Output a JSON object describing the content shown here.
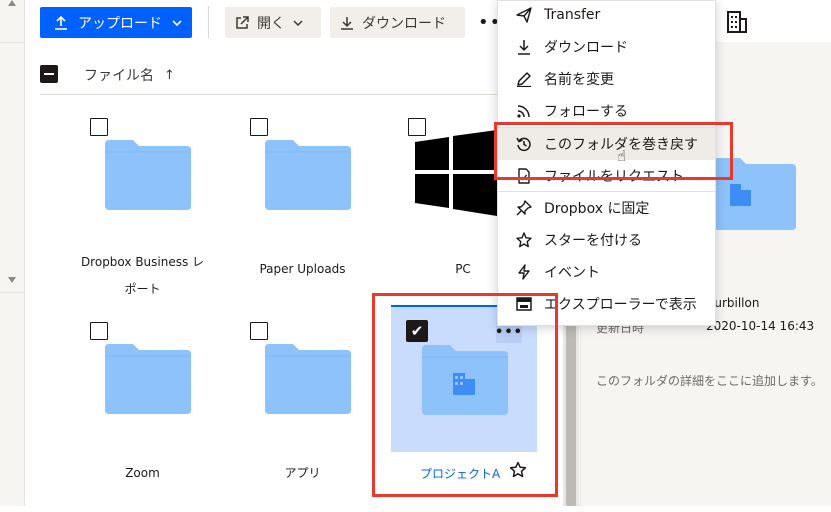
{
  "toolbar": {
    "upload_label": "アップロード",
    "open_label": "開く",
    "download_label": "ダウンロード",
    "more_label": "•••"
  },
  "list_header": {
    "name_label": "ファイル名",
    "sort_indicator": "↑"
  },
  "grid": {
    "items": [
      {
        "label_line1": "Dropbox Business レ",
        "label_line2": "ポート",
        "type": "folder"
      },
      {
        "label": "Paper Uploads",
        "type": "folder"
      },
      {
        "label": "PC",
        "type": "windows"
      },
      {
        "label": "Zoom",
        "type": "folder"
      },
      {
        "label": "アプリ",
        "type": "folder"
      },
      {
        "label": "プロジェクトA",
        "type": "team-folder",
        "selected": true
      }
    ]
  },
  "selected_tile": {
    "more_label": "•••"
  },
  "context_menu": {
    "items": [
      {
        "label": "Transfer",
        "icon": "send-icon"
      },
      {
        "label": "ダウンロード",
        "icon": "download-icon"
      },
      {
        "label": "名前を変更",
        "icon": "pencil-icon"
      },
      {
        "label": "フォローする",
        "icon": "rss-icon"
      },
      {
        "label": "このフォルダを巻き戻す",
        "icon": "history-icon",
        "highlighted": true
      },
      {
        "label": "ファイルをリクエスト",
        "icon": "file-request-icon"
      },
      {
        "label": "Dropbox に固定",
        "icon": "pin-icon"
      },
      {
        "label": "スターを付ける",
        "icon": "star-icon"
      },
      {
        "label": "イベント",
        "icon": "lightning-icon"
      },
      {
        "label": "エクスプローラーで表示",
        "icon": "explorer-icon"
      }
    ]
  },
  "info_panel": {
    "owner_value": "ourbillon",
    "modified_key": "更新日時",
    "modified_value": "2020-10-14 16:43",
    "description_placeholder": "このフォルダの詳細をここに追加します。"
  },
  "colors": {
    "primary": "#0061fe",
    "folder": "#8ec2fb",
    "highlight_red": "#e8392f",
    "selected_bg": "#c9dcfe"
  }
}
